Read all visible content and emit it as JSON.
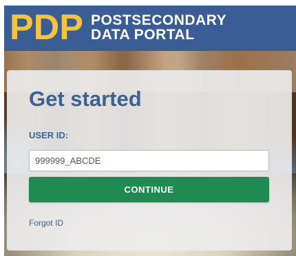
{
  "header": {
    "logo_mark": "PDP",
    "logo_line1": "POSTSECONDARY",
    "logo_line2": "DATA PORTAL"
  },
  "login": {
    "title": "Get started",
    "user_id_label": "USER ID:",
    "user_id_value": "999999_ABCDE",
    "continue_label": "CONTINUE",
    "forgot_label": "Forgot ID"
  },
  "colors": {
    "header_bg": "#3b5d95",
    "logo_accent": "#f4c43a",
    "title_blue": "#3e6190",
    "button_green": "#1f8a52"
  }
}
